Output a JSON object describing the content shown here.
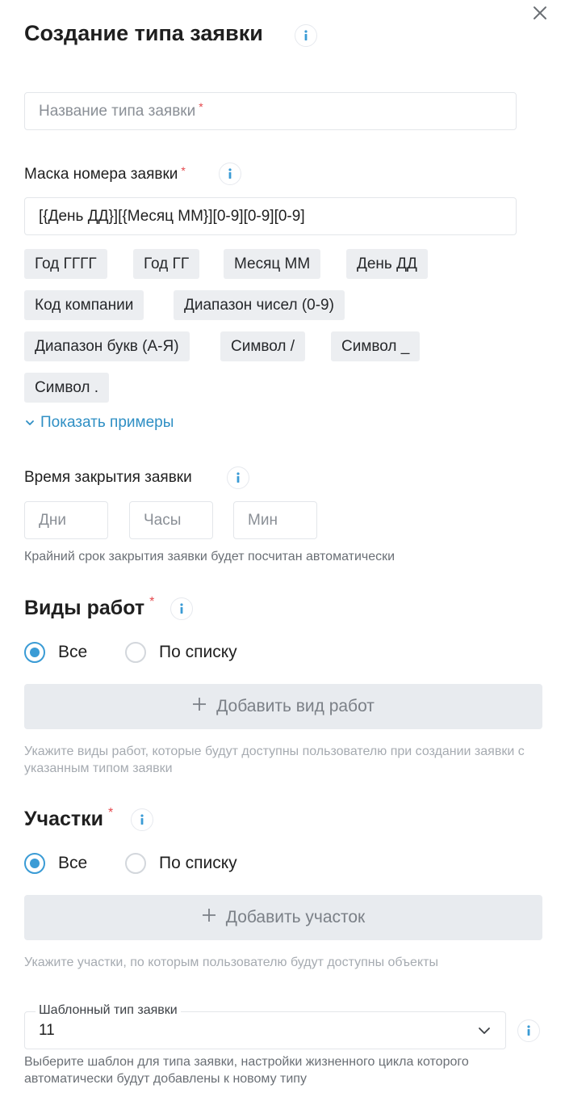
{
  "dialog": {
    "title": "Создание типа заявки",
    "close_icon": "close-icon"
  },
  "name_field": {
    "placeholder": "Название типа заявки",
    "required_mark": "*"
  },
  "mask": {
    "label": "Маска номера заявки",
    "required_mark": "*",
    "value": "[{День ДД}][{Месяц ММ}][0-9][0-9][0-9]",
    "chips": [
      "Год ГГГГ",
      "Год ГГ",
      "Месяц ММ",
      "День ДД",
      "Код компании",
      "Диапазон чисел (0-9)",
      "Диапазон букв (А-Я)",
      "Символ /",
      "Символ _",
      "Символ ."
    ],
    "show_examples": "Показать примеры"
  },
  "close_time": {
    "label": "Время закрытия заявки",
    "days_placeholder": "Дни",
    "hours_placeholder": "Часы",
    "minutes_placeholder": "Мин",
    "hint": "Крайний срок закрытия заявки будет посчитан автоматически"
  },
  "work_types": {
    "title": "Виды работ",
    "required_mark": "*",
    "option_all": "Все",
    "option_list": "По списку",
    "selected": "all",
    "add_label": "Добавить вид работ",
    "hint": "Укажите виды работ, которые будут доступны пользователю при создании заявки с указанным типом заявки"
  },
  "sites": {
    "title": "Участки",
    "required_mark": "*",
    "option_all": "Все",
    "option_list": "По списку",
    "selected": "all",
    "add_label": "Добавить участок",
    "hint": "Укажите участки, по которым пользователю будут доступны объекты"
  },
  "template": {
    "legend": "Шаблонный тип заявки",
    "value": "11",
    "hint": "Выберите шаблон для типа заявки, настройки жизненного цикла которого автоматически будут добавлены к новому типу"
  },
  "colors": {
    "accent": "#3a9bd5",
    "link": "#2f8fc4",
    "required": "#e5484d",
    "chip_bg": "#eceef1",
    "button_bg": "#e8ebef"
  }
}
